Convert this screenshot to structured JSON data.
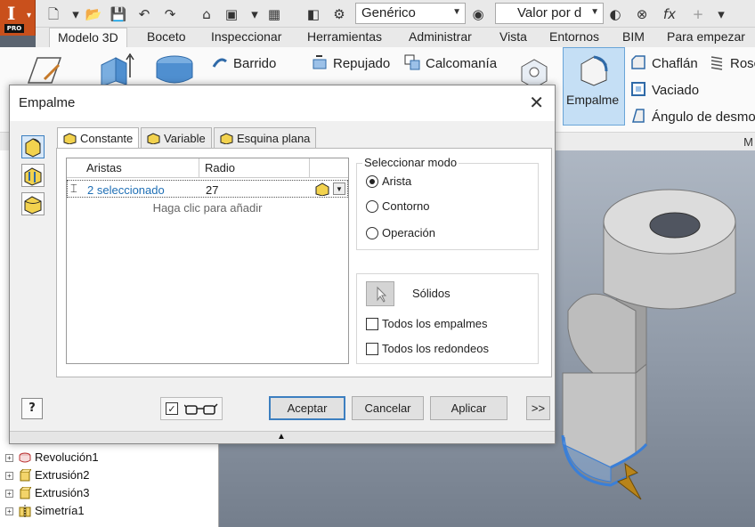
{
  "app": {
    "badge": "PRO",
    "material_value": "Genérico",
    "appearance_value": "Valor por d",
    "fx_label": "fx"
  },
  "ribbon_tabs": [
    "Modelo 3D",
    "Boceto",
    "Inspeccionar",
    "Herramientas",
    "Administrar",
    "Vista",
    "Entornos",
    "BIM",
    "Para empezar"
  ],
  "ribbon": {
    "barrido": "Barrido",
    "repujado": "Repujado",
    "calcomania": "Calcomanía",
    "empalme": "Empalme",
    "chaflan": "Chaflán",
    "rosca": "Rosc",
    "vaciado": "Vaciado",
    "angulo": "Ángulo de desmo",
    "footer_letter": "M"
  },
  "browser": {
    "items": [
      {
        "label": "Revolución1"
      },
      {
        "label": "Extrusión2"
      },
      {
        "label": "Extrusión3"
      },
      {
        "label": "Simetría1"
      }
    ]
  },
  "dialog": {
    "title": "Empalme",
    "tabs": [
      "Constante",
      "Variable",
      "Esquina plana"
    ],
    "grid": {
      "col_aristas": "Aristas",
      "col_radio": "Radio",
      "row_aristas": "2 seleccionado",
      "row_radio": "27",
      "hint": "Haga clic para añadir"
    },
    "mode": {
      "title": "Seleccionar modo",
      "options": [
        "Arista",
        "Contorno",
        "Operación"
      ],
      "selected": "Arista"
    },
    "solids_label": "Sólidos",
    "checkboxes": [
      "Todos los empalmes",
      "Todos los redondeos"
    ],
    "buttons": {
      "ok": "Aceptar",
      "cancel": "Cancelar",
      "apply": "Aplicar",
      "more": ">>"
    }
  },
  "colors": {
    "accent": "#3c7fc0",
    "link_text": "#1f6fb5",
    "app_orange": "#c9501c",
    "selection_highlight": "#c5dff5"
  }
}
